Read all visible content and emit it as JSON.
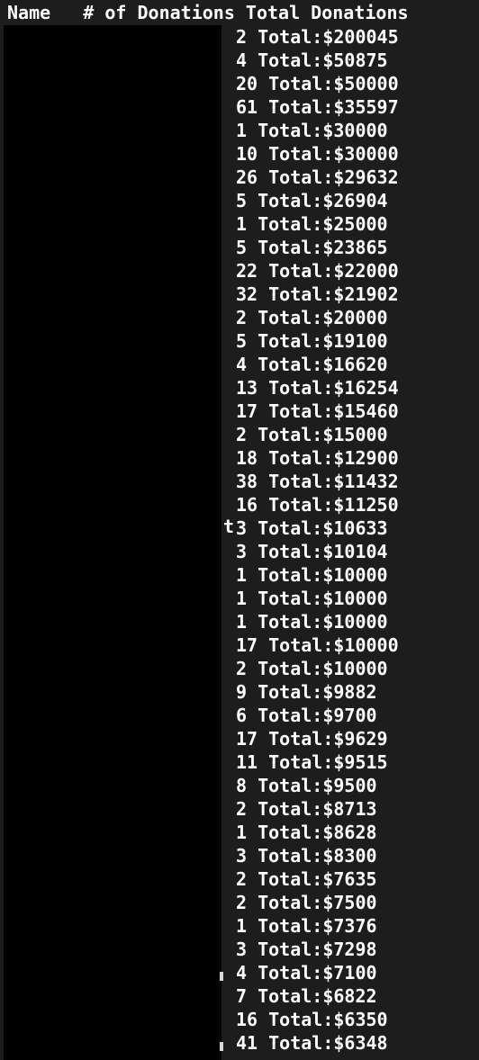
{
  "header": {
    "col_name": "Name",
    "col_count": "# of Donations",
    "col_total": "Total Donations"
  },
  "leak_text": "t",
  "rows": [
    {
      "count": "2",
      "total": "Total:$200045"
    },
    {
      "count": "4",
      "total": "Total:$50875"
    },
    {
      "count": "20",
      "total": "Total:$50000"
    },
    {
      "count": "61",
      "total": "Total:$35597"
    },
    {
      "count": "1",
      "total": "Total:$30000"
    },
    {
      "count": "10",
      "total": "Total:$30000"
    },
    {
      "count": "26",
      "total": "Total:$29632"
    },
    {
      "count": "5",
      "total": "Total:$26904"
    },
    {
      "count": "1",
      "total": "Total:$25000"
    },
    {
      "count": "5",
      "total": "Total:$23865"
    },
    {
      "count": "22",
      "total": "Total:$22000"
    },
    {
      "count": "32",
      "total": "Total:$21902"
    },
    {
      "count": "2",
      "total": "Total:$20000"
    },
    {
      "count": "5",
      "total": "Total:$19100"
    },
    {
      "count": "4",
      "total": "Total:$16620"
    },
    {
      "count": "13",
      "total": "Total:$16254"
    },
    {
      "count": "17",
      "total": "Total:$15460"
    },
    {
      "count": "2",
      "total": "Total:$15000"
    },
    {
      "count": "18",
      "total": "Total:$12900"
    },
    {
      "count": "38",
      "total": "Total:$11432"
    },
    {
      "count": "16",
      "total": "Total:$11250"
    },
    {
      "count": "3",
      "total": "Total:$10633"
    },
    {
      "count": "3",
      "total": "Total:$10104"
    },
    {
      "count": "1",
      "total": "Total:$10000"
    },
    {
      "count": "1",
      "total": "Total:$10000"
    },
    {
      "count": "1",
      "total": "Total:$10000"
    },
    {
      "count": "17",
      "total": "Total:$10000"
    },
    {
      "count": "2",
      "total": "Total:$10000"
    },
    {
      "count": "9",
      "total": "Total:$9882"
    },
    {
      "count": "6",
      "total": "Total:$9700"
    },
    {
      "count": "17",
      "total": "Total:$9629"
    },
    {
      "count": "11",
      "total": "Total:$9515"
    },
    {
      "count": "8",
      "total": "Total:$9500"
    },
    {
      "count": "2",
      "total": "Total:$8713"
    },
    {
      "count": "1",
      "total": "Total:$8628"
    },
    {
      "count": "3",
      "total": "Total:$8300"
    },
    {
      "count": "2",
      "total": "Total:$7635"
    },
    {
      "count": "2",
      "total": "Total:$7500"
    },
    {
      "count": "1",
      "total": "Total:$7376"
    },
    {
      "count": "3",
      "total": "Total:$7298"
    },
    {
      "count": "4",
      "total": "Total:$7100"
    },
    {
      "count": "7",
      "total": "Total:$6822"
    },
    {
      "count": "16",
      "total": "Total:$6350"
    },
    {
      "count": "41",
      "total": "Total:$6348"
    }
  ],
  "colors": {
    "background": "#1d1d1d",
    "redaction": "#000000",
    "text": "#ffffff"
  }
}
